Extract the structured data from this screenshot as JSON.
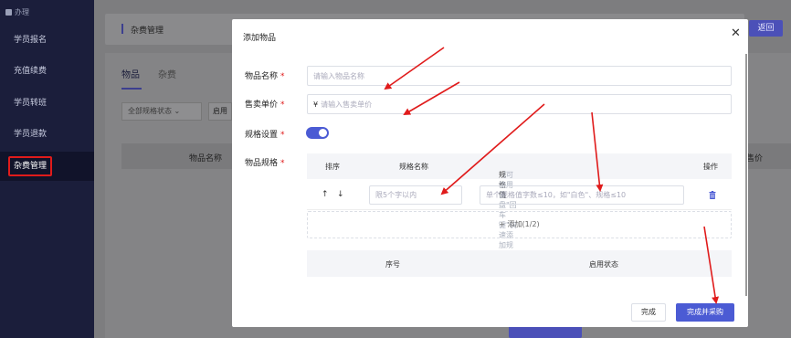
{
  "sidebar": {
    "section_label": "办理",
    "items": [
      {
        "label": "学员报名"
      },
      {
        "label": "充值续费"
      },
      {
        "label": "学员转班"
      },
      {
        "label": "学员退款"
      },
      {
        "label": "杂费管理"
      }
    ]
  },
  "background": {
    "breadcrumb": "杂费管理",
    "return_button": "返回",
    "tabs": [
      "物品",
      "杂费"
    ],
    "filter_select": "全部规格状态",
    "filter_select2": "启用",
    "table_headers": [
      "物品名称",
      "售价"
    ]
  },
  "modal": {
    "title": "添加物品",
    "close_icon": "close-icon",
    "fields": {
      "name_label": "物品名称",
      "name_placeholder": "请输入物品名称",
      "price_label": "售卖单价",
      "price_prefix": "¥",
      "price_placeholder": "请输入售卖单价",
      "spec_setting_label": "规格设置",
      "spec_setting_on": true,
      "spec_label": "物品规格",
      "required_mark": "*"
    },
    "spec_table": {
      "headers": {
        "order": "排序",
        "name": "规格名称",
        "value": "规格值",
        "value_hint": "（可使用键盘\"回车键\"快速添加规格值）",
        "action": "操作"
      },
      "row": {
        "up": "↑",
        "down": "↓",
        "name_placeholder": "限5个字以内",
        "value_placeholder": "单个规格值字数≤10，如\"白色\"、规格≤10"
      },
      "add_label": "+ 添加(1/2)"
    },
    "seq_table": {
      "headers": [
        "序号",
        "启用状态"
      ]
    },
    "buttons": {
      "done": "完成",
      "done_and_buy": "完成并采购"
    }
  },
  "colors": {
    "accent": "#4b5bd4",
    "sidebar_bg": "#1b1e3b",
    "annotation": "#e01b1b"
  }
}
